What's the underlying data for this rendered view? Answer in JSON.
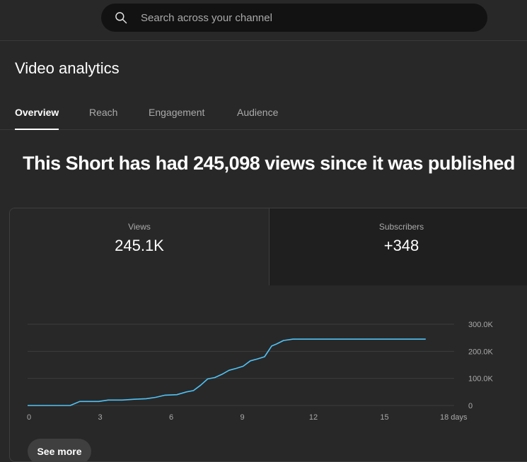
{
  "search": {
    "placeholder": "Search across your channel"
  },
  "page": {
    "title": "Video analytics"
  },
  "tabs": [
    {
      "label": "Overview",
      "active": true
    },
    {
      "label": "Reach",
      "active": false
    },
    {
      "label": "Engagement",
      "active": false
    },
    {
      "label": "Audience",
      "active": false
    }
  ],
  "headline": "This Short has had 245,098 views since it was published",
  "metrics": [
    {
      "label": "Views",
      "value": "245.1K",
      "selected": true
    },
    {
      "label": "Subscribers",
      "value": "+348",
      "selected": false
    }
  ],
  "see_more_label": "See more",
  "colors": {
    "line": "#4fc3f7",
    "grid": "#3c3c3c",
    "axis_text": "#aaaaaa"
  },
  "chart_data": {
    "type": "line",
    "title": "",
    "xlabel": "",
    "ylabel": "",
    "x_ticks": [
      "0",
      "3",
      "6",
      "9",
      "12",
      "15",
      "18 days"
    ],
    "x_tick_values": [
      0,
      3,
      6,
      9,
      12,
      15,
      18
    ],
    "y_ticks": [
      "0",
      "100.0K",
      "200.0K",
      "300.0K"
    ],
    "y_tick_values": [
      0,
      100000,
      200000,
      300000
    ],
    "xlim": [
      0,
      18
    ],
    "ylim": [
      0,
      300000
    ],
    "grid": true,
    "series": [
      {
        "x": [
          0,
          1.8,
          2.2,
          3.0,
          3.4,
          4.0,
          4.5,
          5.0,
          5.4,
          5.8,
          6.3,
          6.7,
          7.0,
          7.3,
          7.6,
          7.9,
          8.2,
          8.5,
          8.8,
          9.1,
          9.4,
          9.7,
          10.0,
          10.3,
          10.5,
          10.8,
          11.2,
          12,
          15,
          16.8
        ],
        "y": [
          0,
          0,
          15000,
          15000,
          20000,
          20000,
          23000,
          25000,
          30000,
          38000,
          40000,
          50000,
          55000,
          75000,
          98000,
          103000,
          115000,
          130000,
          137000,
          145000,
          165000,
          172000,
          180000,
          220000,
          227000,
          240000,
          245000,
          245000,
          245000,
          245000
        ]
      }
    ]
  }
}
